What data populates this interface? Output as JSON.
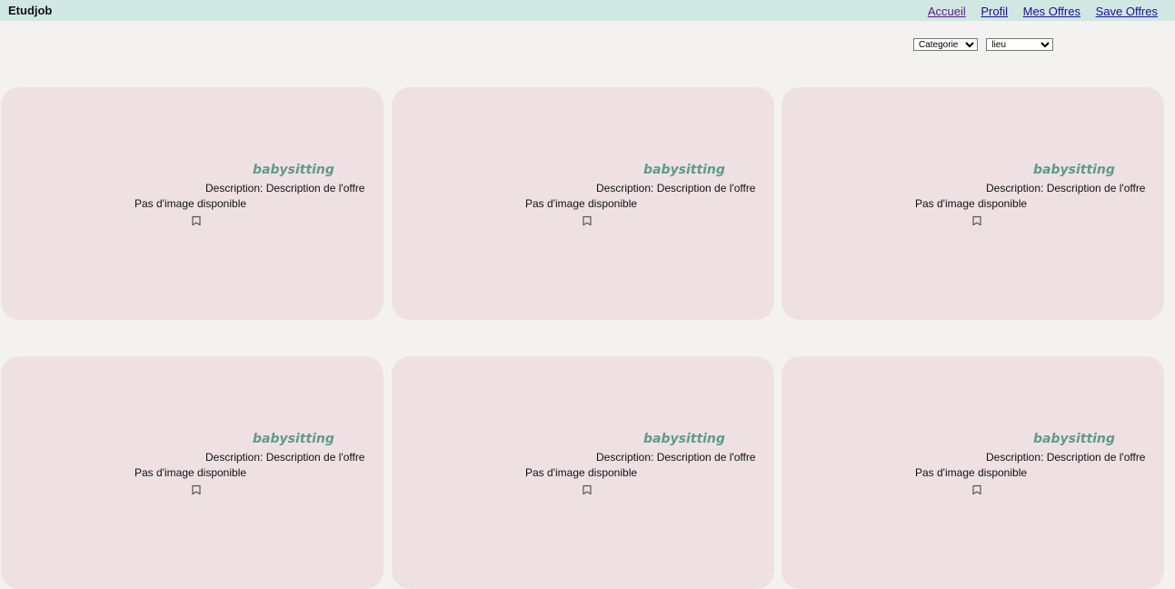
{
  "header": {
    "brand": "Etudjob",
    "nav": [
      {
        "label": "Accueil"
      },
      {
        "label": "Profil"
      },
      {
        "label": "Mes Offres"
      },
      {
        "label": "Save Offres"
      }
    ]
  },
  "filters": {
    "categorie": "Categorie",
    "lieu": "lieu"
  },
  "offers": [
    {
      "title": "babysitting",
      "description": "Description: Description de l'offre",
      "image_text": "Pas d'image disponible",
      "save_icon": "bookmark-icon"
    },
    {
      "title": "babysitting",
      "description": "Description: Description de l'offre",
      "image_text": "Pas d'image disponible",
      "save_icon": "bookmark-icon"
    },
    {
      "title": "babysitting",
      "description": "Description: Description de l'offre",
      "image_text": "Pas d'image disponible",
      "save_icon": "bookmark-icon"
    },
    {
      "title": "babysitting",
      "description": "Description: Description de l'offre",
      "image_text": "Pas d'image disponible",
      "save_icon": "bookmark-icon"
    },
    {
      "title": "babysitting",
      "description": "Description: Description de l'offre",
      "image_text": "Pas d'image disponible",
      "save_icon": "bookmark-icon"
    },
    {
      "title": "babysitting",
      "description": "Description: Description de l'offre",
      "image_text": "Pas d'image disponible",
      "save_icon": "bookmark-icon"
    }
  ],
  "colors": {
    "header_bg": "#d1e8e2",
    "page_bg": "#f3f2f1",
    "card_bg": "#efe1e3",
    "title_color": "#5e9a8f"
  }
}
